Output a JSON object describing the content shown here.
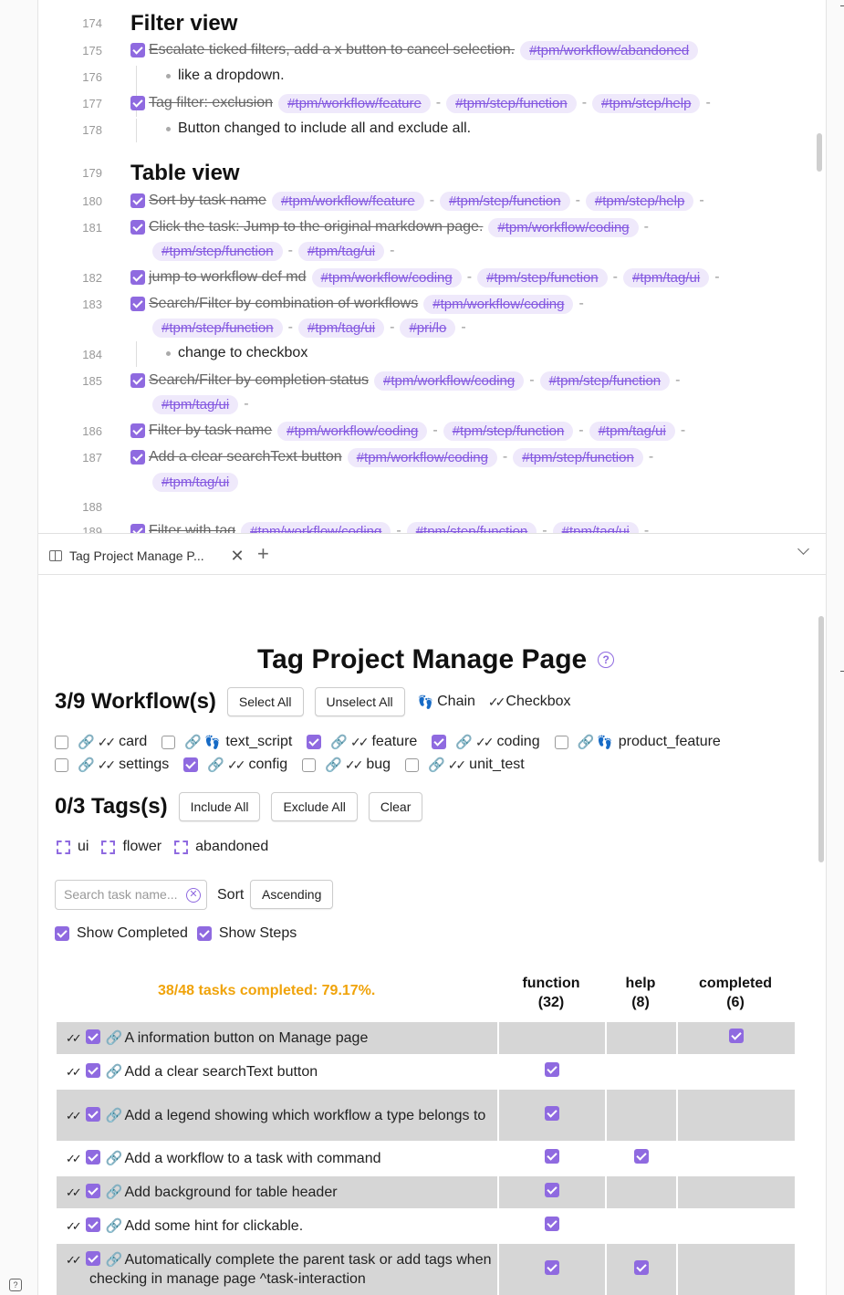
{
  "editor": {
    "sections": {
      "filter_view": {
        "line": "174",
        "title": "Filter view"
      },
      "table_view": {
        "line": "179",
        "title": "Table view"
      }
    },
    "lines": [
      {
        "line": "175",
        "text": "Escalate ticked filters, add a x button to cancel selection.",
        "tags": [
          "#tpm/workflow/abandoned"
        ]
      },
      {
        "line": "176",
        "bullet": "like a dropdown."
      },
      {
        "line": "177",
        "text": "Tag filter: exclusion",
        "tags": [
          "#tpm/workflow/feature",
          "#tpm/step/function",
          "#tpm/step/help"
        ]
      },
      {
        "line": "178",
        "bullet": "Button changed to include all and exclude all."
      },
      {
        "line": "180",
        "text": "Sort by task name",
        "tags": [
          "#tpm/workflow/feature",
          "#tpm/step/function",
          "#tpm/step/help"
        ]
      },
      {
        "line": "181",
        "text": "Click the task: Jump to the original markdown page.",
        "tags": [
          "#tpm/workflow/coding"
        ],
        "tags2": [
          "#tpm/step/function",
          "#tpm/tag/ui"
        ]
      },
      {
        "line": "182",
        "text": "jump to workflow def md",
        "tags": [
          "#tpm/workflow/coding",
          "#tpm/step/function",
          "#tpm/tag/ui"
        ]
      },
      {
        "line": "183",
        "text": "Search/Filter by combination of workflows",
        "tags": [
          "#tpm/workflow/coding"
        ],
        "tags2": [
          "#tpm/step/function",
          "#tpm/tag/ui",
          "#pri/lo"
        ]
      },
      {
        "line": "184",
        "bullet": "change to checkbox"
      },
      {
        "line": "185",
        "text": "Search/Filter by completion status",
        "tags": [
          "#tpm/workflow/coding",
          "#tpm/step/function"
        ],
        "tags2": [
          "#tpm/tag/ui"
        ]
      },
      {
        "line": "186",
        "text": "Filter by task name",
        "tags": [
          "#tpm/workflow/coding",
          "#tpm/step/function",
          "#tpm/tag/ui"
        ]
      },
      {
        "line": "187",
        "text": "Add a clear searchText button",
        "tags": [
          "#tpm/workflow/coding",
          "#tpm/step/function"
        ],
        "tags2": [
          "#tpm/tag/ui"
        ]
      },
      {
        "line": "188"
      },
      {
        "line": "189",
        "text": "Filter with tag",
        "tags": [
          "#tpm/workflow/coding",
          "#tpm/step/function",
          "#tpm/tag/ui"
        ]
      }
    ],
    "dash": "-"
  },
  "tabs": {
    "active_label": "Tag Project Manage P...",
    "close": "✕",
    "new": "+"
  },
  "page": {
    "title": "Tag Project Manage Page",
    "help": "?",
    "workflows": {
      "heading": "3/9 Workflow(s)",
      "select_all": "Select All",
      "unselect_all": "Unselect All",
      "legend_chain": "Chain",
      "legend_checkbox": "Checkbox",
      "items": [
        {
          "name": "card",
          "checked": false,
          "type": "checkbox"
        },
        {
          "name": "text_script",
          "checked": false,
          "type": "chain"
        },
        {
          "name": "feature",
          "checked": true,
          "type": "checkbox"
        },
        {
          "name": "coding",
          "checked": true,
          "type": "checkbox"
        },
        {
          "name": "product_feature",
          "checked": false,
          "type": "chain"
        },
        {
          "name": "settings",
          "checked": false,
          "type": "checkbox"
        },
        {
          "name": "config",
          "checked": true,
          "type": "checkbox"
        },
        {
          "name": "bug",
          "checked": false,
          "type": "checkbox"
        },
        {
          "name": "unit_test",
          "checked": false,
          "type": "checkbox"
        }
      ]
    },
    "tags": {
      "heading": "0/3 Tags(s)",
      "include_all": "Include All",
      "exclude_all": "Exclude All",
      "clear": "Clear",
      "items": [
        "ui",
        "flower",
        "abandoned"
      ]
    },
    "search": {
      "placeholder": "Search task name...",
      "clear": "✕"
    },
    "sort": {
      "label": "Sort",
      "value": "Ascending"
    },
    "options": {
      "show_completed": "Show Completed",
      "show_steps": "Show Steps"
    },
    "summary": "38/48 tasks completed: 79.17%.",
    "columns": [
      {
        "name": "function",
        "count": "(32)"
      },
      {
        "name": "help",
        "count": "(8)"
      },
      {
        "name": "completed",
        "count": "(6)"
      }
    ],
    "rows": [
      {
        "name": "A information button on Manage page",
        "function": false,
        "help": false,
        "completed": true
      },
      {
        "name": "Add a clear searchText button",
        "function": true,
        "help": false,
        "completed": false
      },
      {
        "name": "Add a legend showing which workflow a type belongs to",
        "function": true,
        "help": false,
        "completed": false
      },
      {
        "name": "Add a workflow to a task with command",
        "function": true,
        "help": true,
        "completed": false
      },
      {
        "name": "Add background for table header",
        "function": true,
        "help": false,
        "completed": false
      },
      {
        "name": "Add some hint for clickable.",
        "function": true,
        "help": false,
        "completed": false
      },
      {
        "name": "Automatically complete the parent task or add tags when checking in manage page ^task-interaction",
        "function": true,
        "help": true,
        "completed": false
      }
    ]
  },
  "colors": {
    "accent": "#8f6ae0",
    "tag_bg": "#efe9fb",
    "summary": "#f0a30a",
    "row_grey": "#d6d6d6"
  }
}
